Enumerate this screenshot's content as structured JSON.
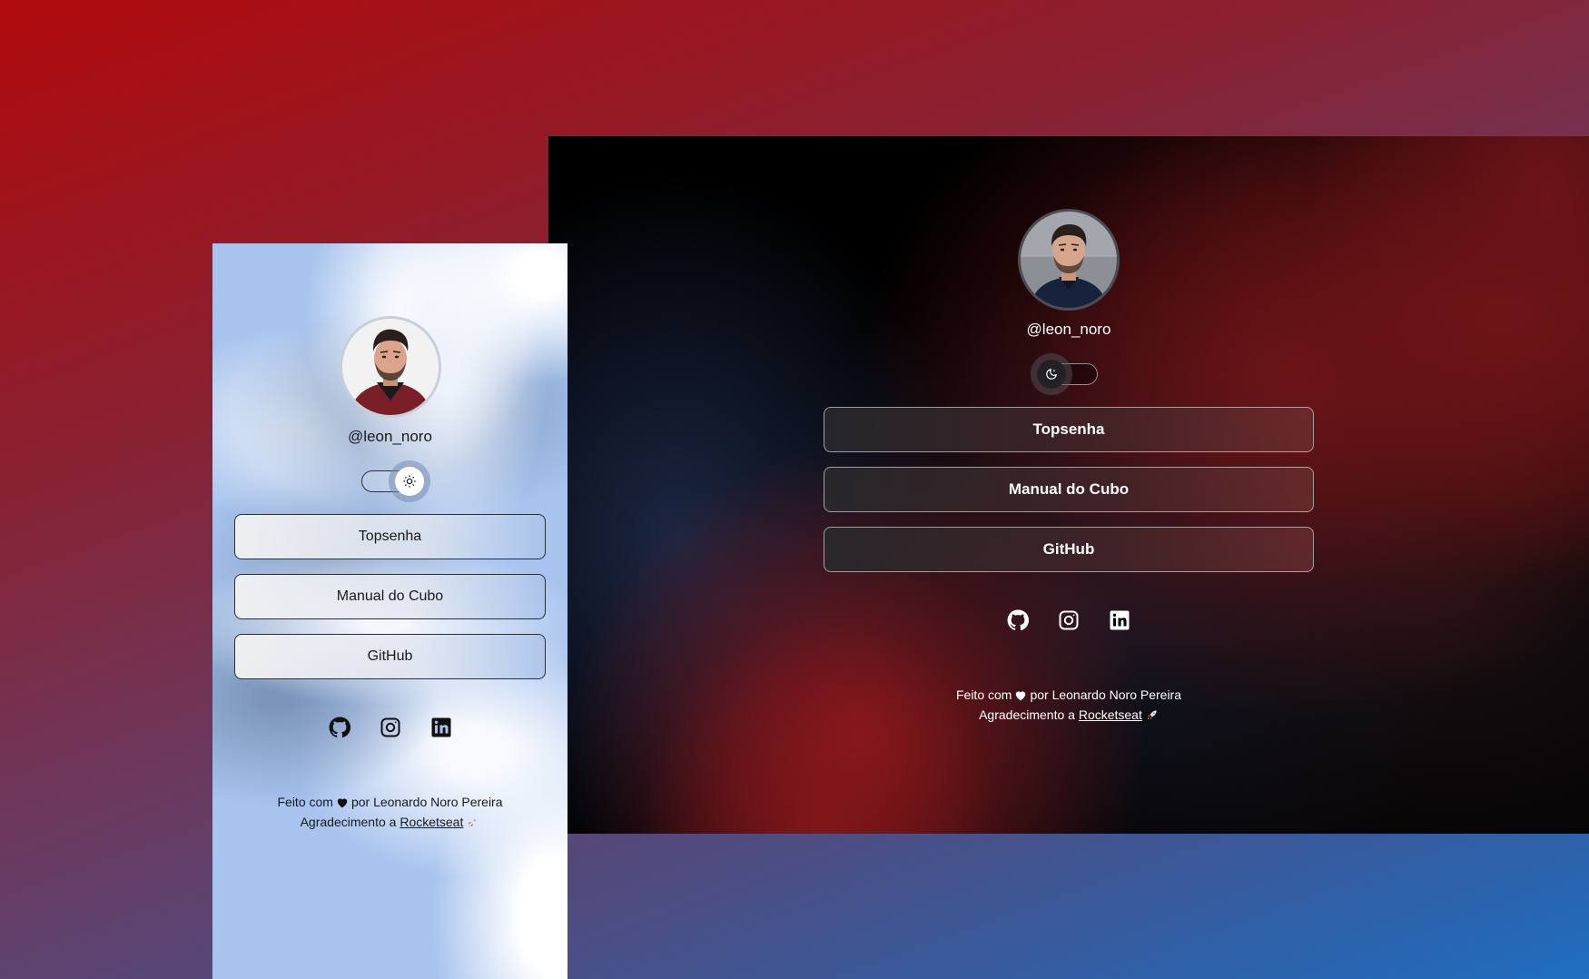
{
  "colors": {
    "bg_red": "#b00a0c",
    "bg_blue": "#1f6ec0",
    "dark_panel": "#000000",
    "dark_accent_red": "#6e1418",
    "light_panel_blue": "#a7c3ee"
  },
  "dark_card": {
    "username": "@leon_noro",
    "theme_toggle": {
      "state": "dark",
      "knob_icon": "moon-icon"
    },
    "links": [
      {
        "label": "Topsenha"
      },
      {
        "label": "Manual do Cubo"
      },
      {
        "label": "GitHub"
      }
    ],
    "social": [
      "github-icon",
      "instagram-icon",
      "linkedin-icon"
    ],
    "footer": {
      "made_with": "Feito com",
      "by": "por Leonardo Noro Pereira",
      "thanks": "Agradecimento a",
      "thanks_link": "Rocketseat"
    }
  },
  "light_card": {
    "username": "@leon_noro",
    "theme_toggle": {
      "state": "light",
      "knob_icon": "sun-icon"
    },
    "links": [
      {
        "label": "Topsenha"
      },
      {
        "label": "Manual do Cubo"
      },
      {
        "label": "GitHub"
      }
    ],
    "social": [
      "github-icon",
      "instagram-icon",
      "linkedin-icon"
    ],
    "footer": {
      "made_with": "Feito com",
      "by": "por Leonardo Noro Pereira",
      "thanks": "Agradecimento a",
      "thanks_link": "Rocketseat"
    }
  }
}
